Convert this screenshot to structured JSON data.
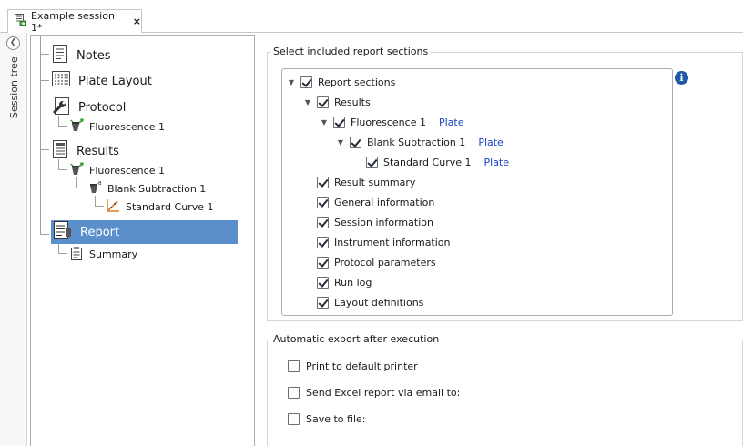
{
  "tab": {
    "title": "Example session 1*",
    "close": "×"
  },
  "session_strip": {
    "label": "Session tree",
    "collapse_glyph": "❮"
  },
  "tree": {
    "notes": "Notes",
    "plate_layout": "Plate Layout",
    "protocol": "Protocol",
    "protocol_fluorescence": "Fluorescence 1",
    "results": "Results",
    "results_fluorescence": "Fluorescence 1",
    "blank_subtraction": "Blank Subtraction 1",
    "standard_curve": "Standard Curve 1",
    "report": "Report",
    "summary": "Summary"
  },
  "sections": {
    "title": "Select included report sections",
    "info": "i",
    "root": {
      "label": "Report sections",
      "checked": true
    },
    "results": {
      "label": "Results",
      "checked": true
    },
    "fluorescence": {
      "label": "Fluorescence 1",
      "link": "Plate",
      "checked": true
    },
    "blank": {
      "label": "Blank Subtraction 1",
      "link": "Plate",
      "checked": true
    },
    "standard": {
      "label": "Standard Curve 1",
      "link": "Plate",
      "checked": true
    },
    "items": [
      {
        "label": "Result summary",
        "checked": true
      },
      {
        "label": "General information",
        "checked": true
      },
      {
        "label": "Session information",
        "checked": true
      },
      {
        "label": "Instrument information",
        "checked": true
      },
      {
        "label": "Protocol parameters",
        "checked": true
      },
      {
        "label": "Run log",
        "checked": true
      },
      {
        "label": "Layout definitions",
        "checked": true
      }
    ]
  },
  "export": {
    "title": "Automatic export after execution",
    "options": [
      {
        "label": "Print to default printer",
        "checked": false
      },
      {
        "label": "Send Excel report via email to:",
        "checked": false
      },
      {
        "label": "Save to file:",
        "checked": false
      }
    ]
  },
  "colors": {
    "selection": "#5b8fcb",
    "link": "#1a45c8",
    "info": "#1e5aa8"
  }
}
